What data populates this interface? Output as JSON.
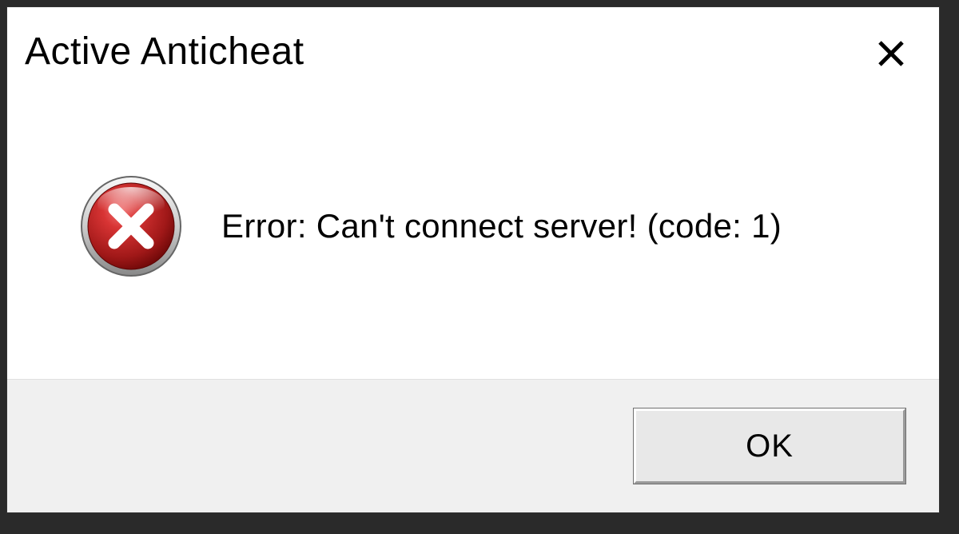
{
  "window": {
    "title": "Active Anticheat"
  },
  "content": {
    "message": "Error: Can't connect server! (code: 1)",
    "icon": "error-icon"
  },
  "buttons": {
    "ok_label": "OK"
  },
  "colors": {
    "error_red_dark": "#8e0c0c",
    "error_red_light": "#d83434",
    "button_bg": "#e8e8e8",
    "footer_bg": "#f0f0f0"
  }
}
